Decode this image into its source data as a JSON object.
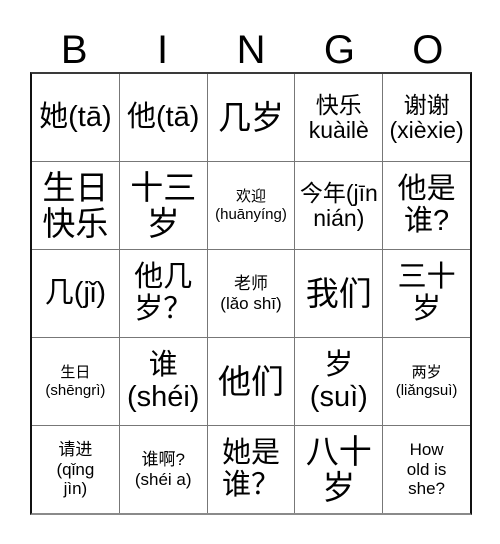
{
  "header": {
    "letters": [
      "B",
      "I",
      "N",
      "G",
      "O"
    ]
  },
  "grid": {
    "rows": [
      [
        {
          "text": "她(tā)",
          "size": "lg"
        },
        {
          "text": "他(tā)",
          "size": "lg"
        },
        {
          "text": "几岁",
          "size": "xl"
        },
        {
          "text": "快乐\nkuàilè",
          "size": "md"
        },
        {
          "text": "谢谢\n(xièxie)",
          "size": "md"
        }
      ],
      [
        {
          "text": "生日\n快乐",
          "size": "xl"
        },
        {
          "text": "十三\n岁",
          "size": "xl"
        },
        {
          "text": "欢迎\n(huānyíng)",
          "size": "xs"
        },
        {
          "text": "今年(jīn\nnián)",
          "size": "md"
        },
        {
          "text": "他是\n谁?",
          "size": "lg"
        }
      ],
      [
        {
          "text": "几(jǐ)",
          "size": "lg"
        },
        {
          "text": "他几\n岁？",
          "size": "lg"
        },
        {
          "text": "老师\n(lǎo shī)",
          "size": "sm"
        },
        {
          "text": "我们",
          "size": "xl"
        },
        {
          "text": "三十\n岁",
          "size": "lg"
        }
      ],
      [
        {
          "text": "生日\n(shēngrì)",
          "size": "xs"
        },
        {
          "text": "谁\n(shéi)",
          "size": "lg"
        },
        {
          "text": "他们",
          "size": "xl"
        },
        {
          "text": "岁\n(suì)",
          "size": "lg"
        },
        {
          "text": "两岁\n(liǎngsuì)",
          "size": "xs"
        }
      ],
      [
        {
          "text": "请进\n(qǐng\njìn)",
          "size": "sm"
        },
        {
          "text": "谁啊?\n(shéi a)",
          "size": "sm"
        },
        {
          "text": "她是\n谁？",
          "size": "lg"
        },
        {
          "text": "八十\n岁",
          "size": "xl"
        },
        {
          "text": "How\nold is\nshe?",
          "size": "sm"
        }
      ]
    ]
  }
}
